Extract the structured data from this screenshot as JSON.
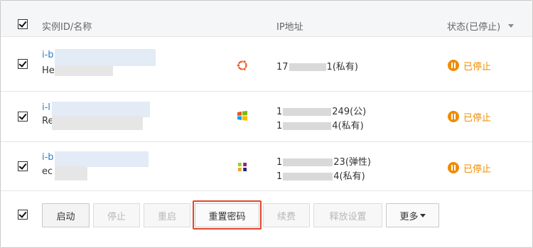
{
  "header": {
    "col_instance": "实例ID/名称",
    "col_ip": "IP地址",
    "col_status": "状态(已停止)"
  },
  "instances": [
    {
      "id_prefix": "i-b",
      "name_prefix": "He",
      "os_icon": "ubuntu-icon",
      "ip_lines": [
        {
          "prefix": "17",
          "suffix": "1(私有)"
        }
      ],
      "status": "已停止"
    },
    {
      "id_prefix": "i-l",
      "name_prefix": "Re",
      "os_icon": "windows-icon",
      "ip_lines": [
        {
          "prefix": "1",
          "suffix": "249(公)"
        },
        {
          "prefix": "1",
          "suffix": "4(私有)"
        }
      ],
      "status": "已停止"
    },
    {
      "id_prefix": "i-b",
      "name_prefix": "ec",
      "os_icon": "centos-icon",
      "ip_lines": [
        {
          "prefix": "1",
          "suffix": "23(弹性)"
        },
        {
          "prefix": "1",
          "suffix": "4(私有)"
        }
      ],
      "status": "已停止"
    }
  ],
  "footer": {
    "start": "启动",
    "stop": "停止",
    "restart": "重启",
    "reset_password": "重置密码",
    "renew": "续费",
    "release_settings": "释放设置",
    "more": "更多"
  },
  "colors": {
    "link": "#2a7ec8",
    "status_stopped": "#f08c00",
    "highlight_border": "#e0462b"
  }
}
